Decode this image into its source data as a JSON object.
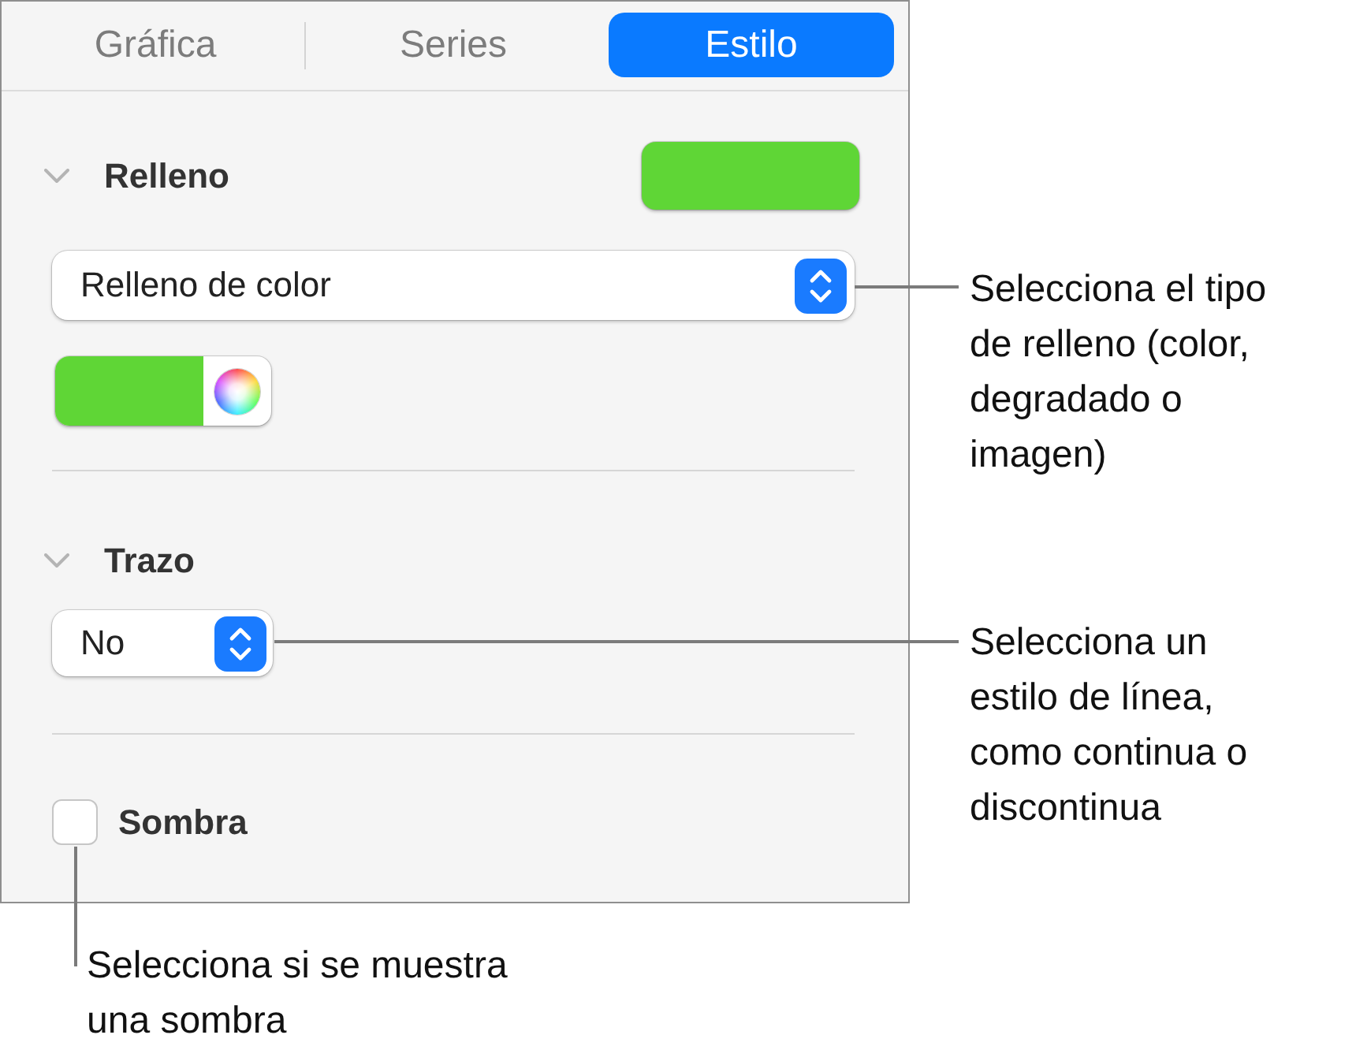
{
  "tabs": [
    {
      "label": "Gráfica",
      "selected": false
    },
    {
      "label": "Series",
      "selected": false
    },
    {
      "label": "Estilo",
      "selected": true
    }
  ],
  "sections": [
    {
      "kind": "fill",
      "title": "Relleno",
      "expanded": true,
      "swatch": {
        "color": "#5fd636"
      },
      "popup": {
        "value": "Relleno de color"
      },
      "color_well": {
        "color": "#5fd636"
      }
    },
    {
      "kind": "stroke",
      "title": "Trazo",
      "expanded": true,
      "popup": {
        "value": "No"
      }
    }
  ],
  "shadow": {
    "label": "Sombra",
    "checked": false
  },
  "callouts": [
    {
      "text": "Selecciona el tipo de relleno (color, degradado o imagen)"
    },
    {
      "text": "Selecciona un estilo de línea, como continua o discontinua"
    },
    {
      "text": "Selecciona si se muestra una sombra"
    }
  ]
}
